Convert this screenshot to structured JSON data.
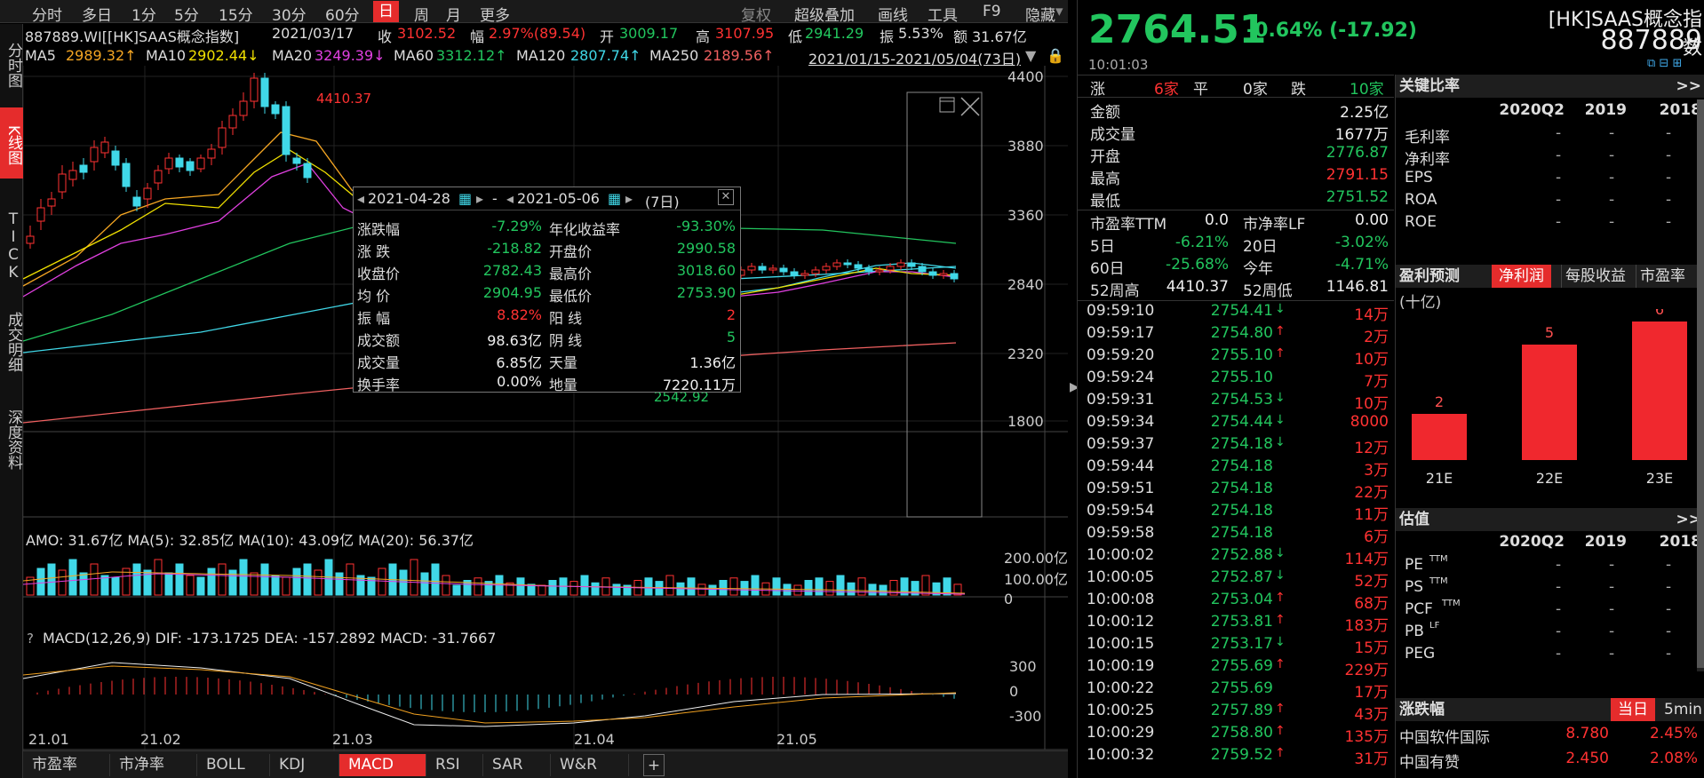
{
  "topbar": {
    "tabs": [
      "分时",
      "多日",
      "1分",
      "5分",
      "15分",
      "30分",
      "60分",
      "日",
      "周",
      "月",
      "更多"
    ],
    "tools": [
      "复权",
      "超级叠加",
      "画线",
      "工具",
      "F9",
      "隐藏"
    ]
  },
  "vtabs": [
    "分时图",
    "K线图",
    "TICK",
    "成交明细",
    "深度资料"
  ],
  "info1": {
    "code": "887889.WI[[HK]SAAS概念指数]",
    "date": "2021/03/17",
    "close_l": "收",
    "close": "3102.52",
    "chg_l": "幅",
    "chg": "2.97%(89.54)",
    "open_l": "开",
    "open": "3009.17",
    "high_l": "高",
    "high": "3107.95",
    "low_l": "低",
    "low": "2941.29",
    "amp_l": "振",
    "amp": "5.53%",
    "amt_l": "额",
    "amt": "31.67亿"
  },
  "info2": {
    "ma5": "MA5",
    "ma5v": "2989.32↑",
    "ma10": "MA10",
    "ma10v": "2902.44↓",
    "ma20": "MA20",
    "ma20v": "3249.39↓",
    "ma60": "MA60",
    "ma60v": "3312.12↑",
    "ma120": "MA120",
    "ma120v": "2807.74↑",
    "ma250": "MA250",
    "ma250v": "2189.56↑",
    "range": "2021/01/15-2021/05/04(73日)"
  },
  "chart_data": {
    "type": "candlestick",
    "yticks": [
      "4400",
      "3880",
      "3360",
      "2840",
      "2320",
      "1800"
    ],
    "xticks": [
      "21.01",
      "21.02",
      "21.03",
      "21.04",
      "21.05"
    ],
    "max_label": "4410.37",
    "min_label": "2542.92",
    "amo_label": "AMO: 31.67亿 MA(5): 32.85亿 MA(10): 43.09亿 MA(20): 56.37亿",
    "amo_ticks": [
      "200.00亿",
      "100.00亿",
      "0"
    ],
    "macd_label": "MACD(12,26,9) DIF: -173.1725 DEA: -157.2892 MACD: -31.7667",
    "macd_ticks": [
      "300",
      "0",
      "-300"
    ]
  },
  "tip": {
    "from": "2021-04-28",
    "to": "2021-05-06",
    "days": "(7日)",
    "dash": "-",
    "rows": [
      [
        "涨跌幅",
        "-7.29%",
        "年化收益率",
        "-93.30%"
      ],
      [
        "涨 跌",
        "-218.82",
        "开盘价",
        "2990.58"
      ],
      [
        "收盘价",
        "2782.43",
        "最高价",
        "3018.60"
      ],
      [
        "均 价",
        "2904.95",
        "最低价",
        "2753.90"
      ],
      [
        "振 幅",
        "8.82%",
        "阳 线",
        "2"
      ],
      [
        "成交额",
        "98.63亿",
        "阴 线",
        "5"
      ],
      [
        "成交量",
        "6.85亿",
        "天量",
        "1.36亿"
      ],
      [
        "换手率",
        "0.00%",
        "地量",
        "7220.11万"
      ]
    ]
  },
  "bottabs": [
    "市盈率",
    "市净率",
    "BOLL",
    "KDJ",
    "MACD",
    "RSI",
    "SAR",
    "W&R"
  ],
  "quote": {
    "price": "2764.51",
    "chg": "-0.64% (-17.92)",
    "time": "10:01:03",
    "name": "[HK]SAAS概念指数",
    "code": "887889"
  },
  "breadth": {
    "up_l": "涨",
    "up": "6家",
    "flat_l": "平",
    "flat": "0家",
    "down_l": "跌",
    "down": "10家"
  },
  "stats": [
    [
      "金额",
      "2.25亿",
      "wht"
    ],
    [
      "成交量",
      "1677万",
      "wht"
    ],
    [
      "开盘",
      "2776.87",
      "grn"
    ],
    [
      "最高",
      "2791.15",
      "red"
    ],
    [
      "最低",
      "2751.52",
      "grn"
    ]
  ],
  "stats2": [
    [
      "市盈率TTM",
      "0.0",
      "市净率LF",
      "0.00"
    ],
    [
      "5日",
      "-6.21%",
      "20日",
      "-3.02%"
    ],
    [
      "60日",
      "-25.68%",
      "今年",
      "-4.71%"
    ],
    [
      "52周高",
      "4410.37",
      "52周低",
      "1146.81"
    ]
  ],
  "ticks": [
    [
      "09:59:10",
      "2754.41",
      "↓",
      "14万"
    ],
    [
      "09:59:17",
      "2754.80",
      "↑",
      "2万"
    ],
    [
      "09:59:20",
      "2755.10",
      "↑",
      "10万"
    ],
    [
      "09:59:24",
      "2755.10",
      "",
      "7万"
    ],
    [
      "09:59:31",
      "2754.53",
      "↓",
      "10万"
    ],
    [
      "09:59:34",
      "2754.44",
      "↓",
      "8000"
    ],
    [
      "09:59:37",
      "2754.18",
      "↓",
      "12万"
    ],
    [
      "09:59:44",
      "2754.18",
      "",
      "3万"
    ],
    [
      "09:59:51",
      "2754.18",
      "",
      "22万"
    ],
    [
      "09:59:54",
      "2754.18",
      "",
      "11万"
    ],
    [
      "09:59:58",
      "2754.18",
      "",
      "6万"
    ],
    [
      "10:00:02",
      "2752.88",
      "↓",
      "114万"
    ],
    [
      "10:00:05",
      "2752.87",
      "↓",
      "52万"
    ],
    [
      "10:00:08",
      "2753.04",
      "↑",
      "68万"
    ],
    [
      "10:00:12",
      "2753.81",
      "↑",
      "183万"
    ],
    [
      "10:00:15",
      "2753.17",
      "↓",
      "15万"
    ],
    [
      "10:00:19",
      "2755.69",
      "↑",
      "229万"
    ],
    [
      "10:00:22",
      "2755.69",
      "",
      "17万"
    ],
    [
      "10:00:25",
      "2757.89",
      "↑",
      "43万"
    ],
    [
      "10:00:29",
      "2758.80",
      "↑",
      "135万"
    ],
    [
      "10:00:32",
      "2759.52",
      "↑",
      "31万"
    ]
  ],
  "ratios": {
    "title": "关键比率",
    "more": ">>",
    "cols": [
      "2020Q2",
      "2019",
      "2018"
    ],
    "rows": [
      "毛利率",
      "净利率",
      "EPS",
      "ROA",
      "ROE"
    ],
    "dash": "-"
  },
  "forecast": {
    "tabs": [
      "盈利预测",
      "净利润",
      "每股收益",
      "市盈率"
    ],
    "unit": "(十亿)",
    "bars": [
      {
        "label": "21E",
        "value": 2
      },
      {
        "label": "22E",
        "value": 5
      },
      {
        "label": "23E",
        "value": 6
      }
    ]
  },
  "valuation": {
    "title": "估值",
    "more": ">>",
    "cols": [
      "2020Q2",
      "2019",
      "2018"
    ],
    "rows": [
      "PE",
      "PS",
      "PCF",
      "PB",
      "PEG"
    ],
    "sup": [
      "TTM",
      "TTM",
      "TTM",
      "LF",
      ""
    ],
    "dash": "-"
  },
  "movers": {
    "title": "涨跌幅",
    "tabs": [
      "当日",
      "5min"
    ],
    "rows": [
      [
        "中国软件国际",
        "8.780",
        "2.45%"
      ],
      [
        "中国有赞",
        "2.450",
        "2.08%"
      ]
    ]
  }
}
